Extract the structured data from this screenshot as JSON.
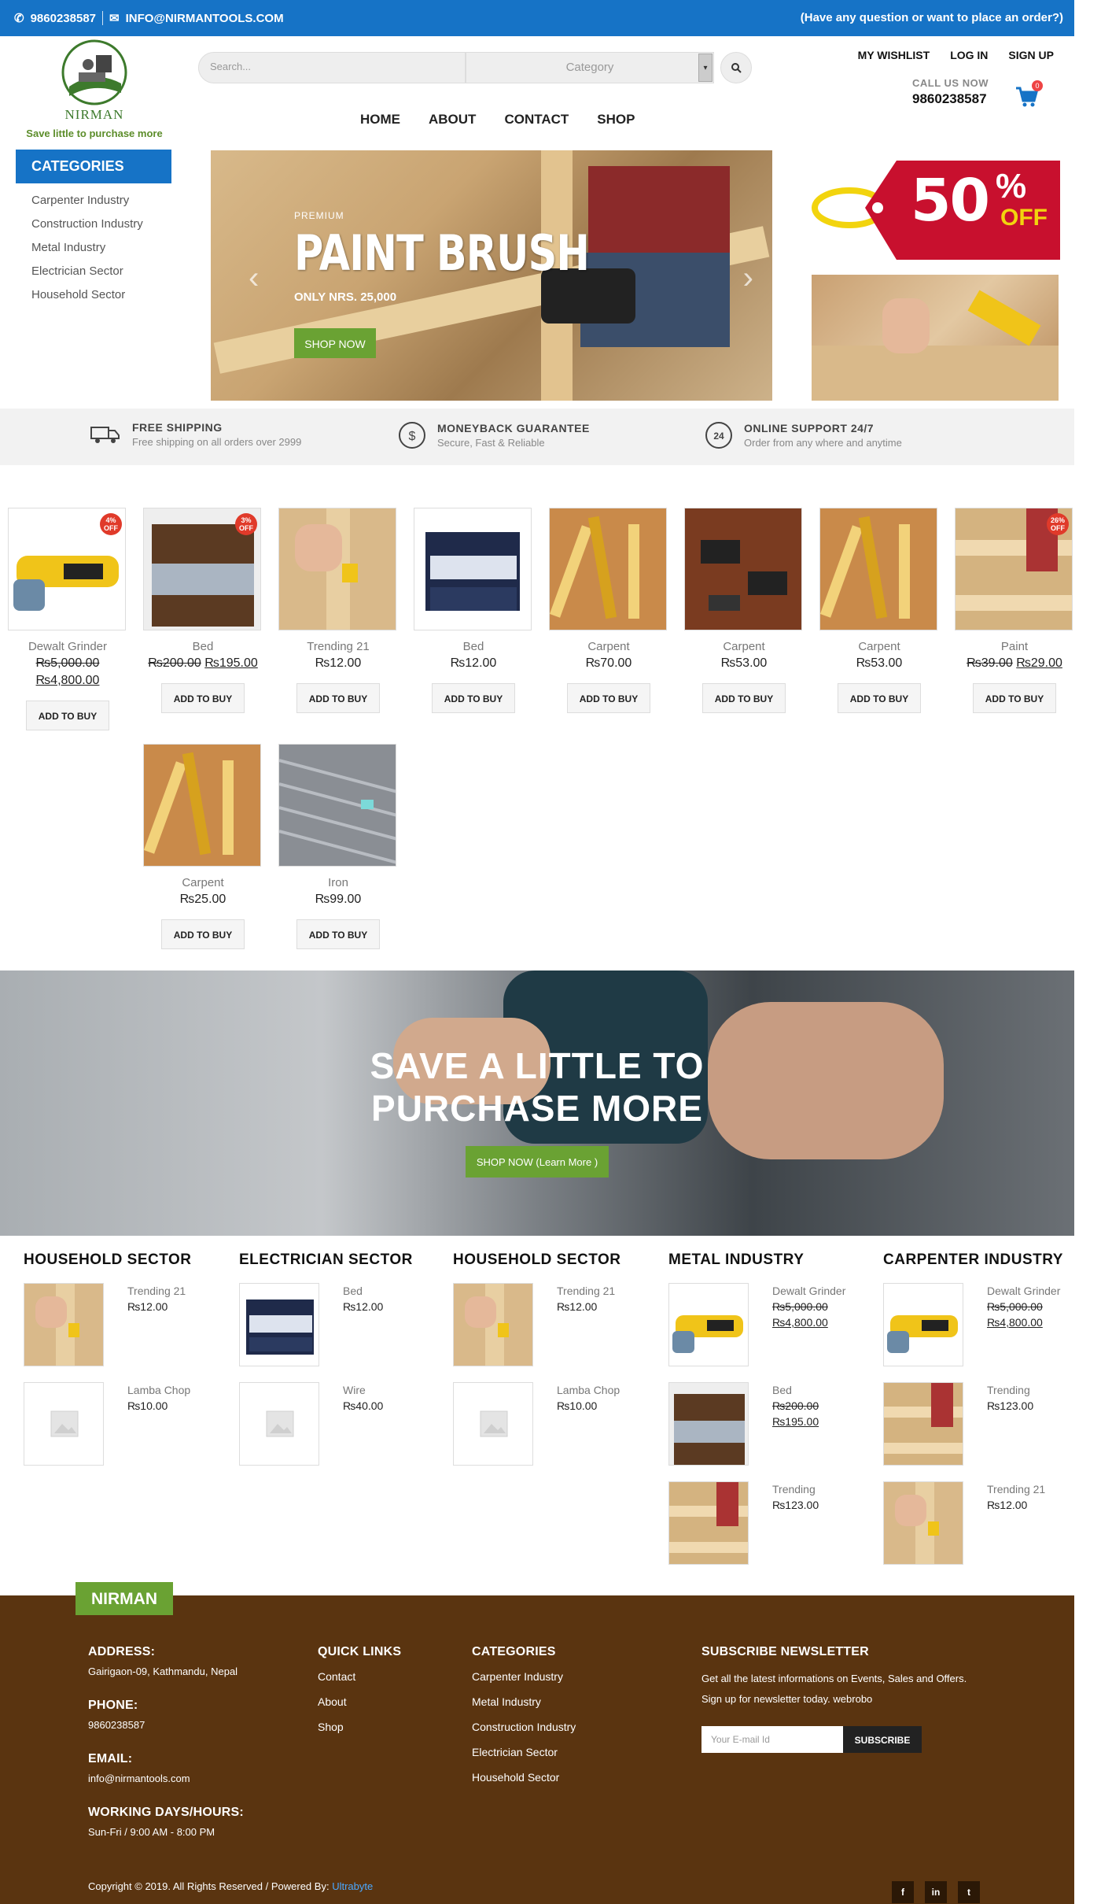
{
  "topbar": {
    "phone": "9860238587",
    "email": "INFO@NIRMANTOOLS.COM",
    "question": "(Have any question or want to place an order?)"
  },
  "logo": {
    "name": "NIRMAN",
    "tagline": "Save little to purchase more"
  },
  "search": {
    "placeholder": "Search...",
    "category": "Category"
  },
  "toplinks": [
    "MY WISHLIST",
    "LOG IN",
    "SIGN UP"
  ],
  "call": {
    "label": "CALL US NOW",
    "number": "9860238587",
    "cart_count": "0"
  },
  "nav": [
    "HOME",
    "ABOUT",
    "CONTACT",
    "SHOP"
  ],
  "categories": {
    "title": "CATEGORIES",
    "items": [
      "Carpenter Industry",
      "Construction Industry",
      "Metal Industry",
      "Electrician Sector",
      "Household Sector"
    ]
  },
  "hero": {
    "kicker": "PREMIUM",
    "title": "PAINT BRUSH",
    "price": "ONLY NRS. 25,000",
    "button": "SHOP NOW"
  },
  "sale": {
    "big": "50",
    "pct": "%",
    "off": "OFF"
  },
  "features": [
    {
      "title": "FREE SHIPPING",
      "sub": "Free shipping on all orders over 2999",
      "icon": "truck-icon"
    },
    {
      "title": "MONEYBACK GUARANTEE",
      "sub": "Secure, Fast & Reliable",
      "icon": "dollar-icon"
    },
    {
      "title": "ONLINE SUPPORT 24/7",
      "sub": "Order from any where and anytime",
      "icon": "support-24-icon"
    }
  ],
  "products": [
    {
      "name": "Dewalt Grinder",
      "old": "₨5,000.00",
      "price": "₨4,800.00",
      "disc": "4% OFF",
      "button": "ADD TO BUY"
    },
    {
      "name": "Bed",
      "old": "₨200.00",
      "price": "₨195.00",
      "disc": "3% OFF",
      "button": "ADD TO BUY"
    },
    {
      "name": "Trending 21",
      "old": "",
      "price": "₨12.00",
      "disc": "",
      "button": "ADD TO BUY"
    },
    {
      "name": "Bed",
      "old": "",
      "price": "₨12.00",
      "disc": "",
      "button": "ADD TO BUY"
    },
    {
      "name": "Carpent",
      "old": "",
      "price": "₨70.00",
      "disc": "",
      "button": "ADD TO BUY"
    },
    {
      "name": "Carpent",
      "old": "",
      "price": "₨53.00",
      "disc": "",
      "button": "ADD TO BUY"
    },
    {
      "name": "Carpent",
      "old": "",
      "price": "₨53.00",
      "disc": "",
      "button": "ADD TO BUY"
    },
    {
      "name": "Paint",
      "old": "₨39.00",
      "price": "₨29.00",
      "disc": "26% OFF",
      "button": "ADD TO BUY"
    },
    {
      "name": "Carpent",
      "old": "",
      "price": "₨25.00",
      "disc": "",
      "button": "ADD TO BUY"
    },
    {
      "name": "Iron",
      "old": "",
      "price": "₨99.00",
      "disc": "",
      "button": "ADD TO BUY"
    }
  ],
  "banner": {
    "line1": "SAVE A LITTLE TO",
    "line2": "PURCHASE MORE",
    "button": "SHOP NOW (Learn More )"
  },
  "sectors": [
    {
      "title": "HOUSEHOLD SECTOR",
      "items": [
        {
          "name": "Trending 21",
          "old": "",
          "price": "₨12.00"
        },
        {
          "name": "Lamba Chop",
          "old": "",
          "price": "₨10.00"
        }
      ]
    },
    {
      "title": "ELECTRICIAN SECTOR",
      "items": [
        {
          "name": "Bed",
          "old": "",
          "price": "₨12.00"
        },
        {
          "name": "Wire",
          "old": "",
          "price": "₨40.00"
        }
      ]
    },
    {
      "title": "HOUSEHOLD SECTOR",
      "items": [
        {
          "name": "Trending 21",
          "old": "",
          "price": "₨12.00"
        },
        {
          "name": "Lamba Chop",
          "old": "",
          "price": "₨10.00"
        }
      ]
    },
    {
      "title": "METAL INDUSTRY",
      "items": [
        {
          "name": "Dewalt Grinder",
          "old": "₨5,000.00",
          "price": "₨4,800.00"
        },
        {
          "name": "Bed",
          "old": "₨200.00",
          "price": "₨195.00"
        },
        {
          "name": "Trending",
          "old": "",
          "price": "₨123.00"
        }
      ]
    },
    {
      "title": "CARPENTER INDUSTRY",
      "items": [
        {
          "name": "Dewalt Grinder",
          "old": "₨5,000.00",
          "price": "₨4,800.00"
        },
        {
          "name": "Trending",
          "old": "",
          "price": "₨123.00"
        },
        {
          "name": "Trending 21",
          "old": "",
          "price": "₨12.00"
        }
      ]
    }
  ],
  "footer": {
    "tag": "NIRMAN",
    "address_label": "ADDRESS:",
    "address": "Gairigaon-09, Kathmandu, Nepal",
    "phone_label": "PHONE:",
    "phone": "9860238587",
    "email_label": "EMAIL:",
    "email": "info@nirmantools.com",
    "hours_label": "WORKING DAYS/HOURS:",
    "hours": "Sun-Fri / 9:00 AM - 8:00 PM",
    "quick_title": "QUICK LINKS",
    "quick": [
      "Contact",
      "About",
      "Shop"
    ],
    "cat_title": "CATEGORIES",
    "cats": [
      "Carpenter Industry",
      "Metal Industry",
      "Construction Industry",
      "Electrician Sector",
      "Household Sector"
    ],
    "news_title": "SUBSCRIBE NEWSLETTER",
    "news_text": "Get all the latest informations on Events, Sales and Offers. Sign up for newsletter today. webrobo",
    "news_placeholder": "Your E-mail Id",
    "news_button": "SUBSCRIBE",
    "copyright": "Copyright © 2019. All Rights Reserved / Powered By:",
    "powered": "Ultrabyte",
    "social": [
      "f",
      "in",
      "t"
    ]
  },
  "colors": {
    "brand_blue": "#1673c6",
    "brand_green": "#6aa233",
    "footer_brown": "#5a3410",
    "sale_red": "#c8102e"
  }
}
